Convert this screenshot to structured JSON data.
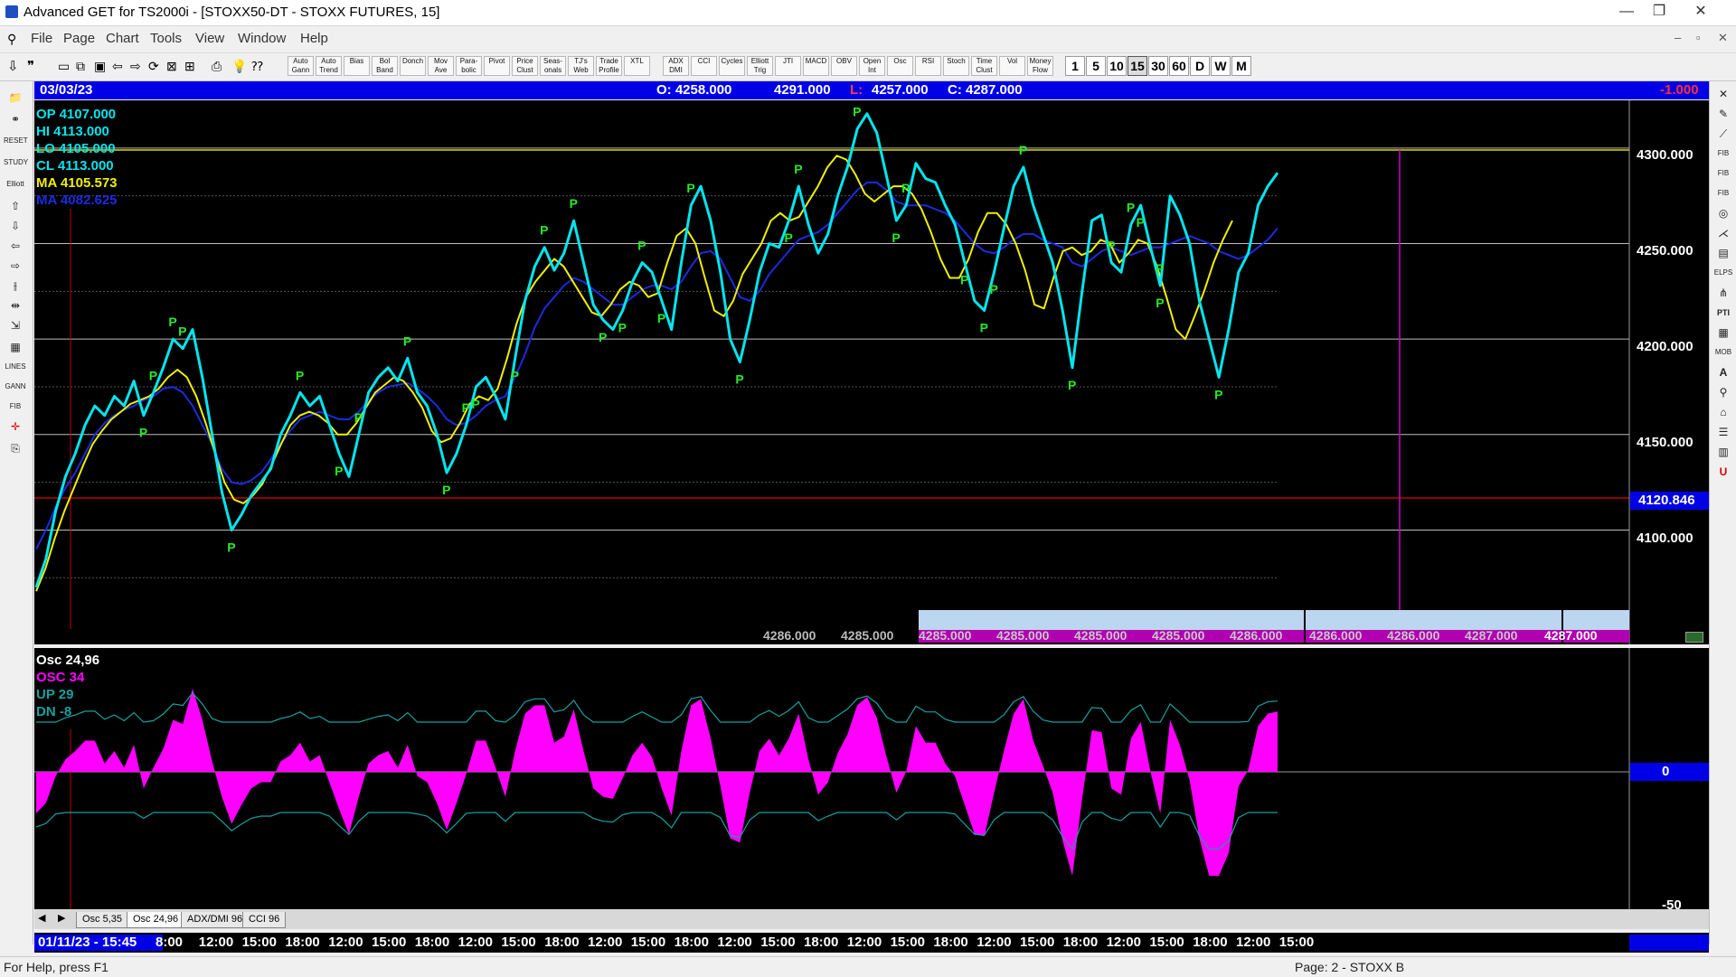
{
  "window": {
    "title": "Advanced GET for TS2000i - [STOXX50-DT - STOXX FUTURES, 15]",
    "minimize": "—",
    "restore": "❐",
    "close": "✕",
    "child_min": "–",
    "child_restore": "▫",
    "child_close": "✕"
  },
  "menu": [
    "File",
    "Page",
    "Chart",
    "Tools",
    "View",
    "Window",
    "Help"
  ],
  "toolbar": {
    "study_buttons": [
      "Auto Gann",
      "Auto Trend",
      "Bias",
      "Bol Band",
      "Donch",
      "Mov Ave",
      "Para- bolic",
      "Pivot",
      "Price Clust",
      "Seas- onals",
      "TJ's Web",
      "Trade Profile",
      "XTL",
      "ADX DMI",
      "CCI",
      "Cycles",
      "Elliott Trig",
      "JTI",
      "MACD",
      "OBV",
      "Open Int",
      "Osc",
      "RSI",
      "Stoch",
      "Time Clust",
      "Vol",
      "Money Flow"
    ],
    "timeframes": [
      "1",
      "5",
      "10",
      "15",
      "30",
      "60",
      "D",
      "W",
      "M"
    ],
    "active_timeframe": "15"
  },
  "infobar": {
    "date": "03/03/23",
    "open": "O: 4258.000",
    "high": "4291.000",
    "low_label": "L:",
    "low": "4257.000",
    "close": "C: 4287.000",
    "change": "-1.000"
  },
  "legend": {
    "op": "OP  4107.000",
    "hi": "HI   4113.000",
    "lo": "LO  4105.000",
    "cl": "CL  4113.000",
    "ma1": "MA  4105.573",
    "ma2": "MA  4082.625"
  },
  "price_axis": {
    "labels": [
      "4300.000",
      "4250.000",
      "4200.000",
      "4150.000",
      "4100.000"
    ],
    "marker": "4120.846"
  },
  "price_clusters": [
    "4286.000",
    "4285.000",
    "4285.000",
    "4285.000",
    "4285.000",
    "4285.000",
    "4286.000",
    "4286.000",
    "4286.000",
    "4287.000",
    "4287.000"
  ],
  "oscillator": {
    "title": "Osc 24,96",
    "osc": "OSC 34",
    "up": "UP   29",
    "dn": "DN   -8",
    "zero": "0",
    "minus50": "-50"
  },
  "tabs": [
    "Osc 5,35",
    "Osc 24,96",
    "ADX/DMI 96",
    "CCI 96"
  ],
  "time_axis": [
    "01/11/23 - 15:45",
    "8:00",
    "12:00",
    "15:00",
    "18:00",
    "12:00",
    "15:00",
    "18:00",
    "12:00",
    "15:00",
    "18:00",
    "12:00",
    "15:00",
    "18:00",
    "12:00",
    "15:00",
    "18:00",
    "12:00",
    "15:00",
    "18:00",
    "12:00",
    "15:00",
    "18:00",
    "12:00",
    "15:00",
    "18:00",
    "12:00",
    "15:00"
  ],
  "status": {
    "help": "For Help, press F1",
    "page": "Page: 2 - STOXX B"
  },
  "colors": {
    "price": "#00e5ee",
    "ma_fast": "#f0f000",
    "ma_slow": "#1a2be0",
    "pivot": "#27e827",
    "osc": "#ff00ff"
  },
  "chart_data": {
    "type": "line",
    "ylim": [
      4060,
      4325
    ],
    "series": [
      {
        "values": [
          4070,
          4085,
          4110,
          4128,
          4140,
          4155,
          4165,
          4160,
          4170,
          4165,
          4178,
          4160,
          4172,
          4185,
          4200,
          4195,
          4205,
          4180,
          4150,
          4120,
          4100,
          4108,
          4118,
          4125,
          4132,
          4150,
          4160,
          4172,
          4165,
          4170,
          4155,
          4140,
          4128,
          4150,
          4172,
          4180,
          4185,
          4178,
          4190,
          4172,
          4165,
          4150,
          4130,
          4140,
          4155,
          4175,
          4180,
          4170,
          4158,
          4190,
          4220,
          4238,
          4248,
          4236,
          4245,
          4262,
          4240,
          4218,
          4210,
          4205,
          4215,
          4230,
          4240,
          4235,
          4220,
          4205,
          4240,
          4270,
          4280,
          4262,
          4235,
          4200,
          4188,
          4210,
          4235,
          4250,
          4248,
          4262,
          4280,
          4260,
          4245,
          4255,
          4275,
          4290,
          4310,
          4318,
          4308,
          4285,
          4262,
          4270,
          4292,
          4284,
          4282,
          4270,
          4260,
          4240,
          4220,
          4215,
          4235,
          4258,
          4280,
          4290,
          4270,
          4255,
          4240,
          4215,
          4185,
          4225,
          4262,
          4265,
          4240,
          4235,
          4260,
          4270,
          4248,
          4228,
          4275,
          4265,
          4250,
          4220,
          4200,
          4180,
          4205,
          4235,
          4245,
          4270,
          4280,
          4287
        ]
      },
      {
        "values": [
          4090,
          4100,
          4112,
          4122,
          4130,
          4140,
          4150,
          4156,
          4160,
          4163,
          4165,
          4168,
          4170,
          4174,
          4175,
          4172,
          4165,
          4155,
          4145,
          4132,
          4125,
          4124,
          4126,
          4130,
          4137,
          4145,
          4152,
          4158,
          4160,
          4162,
          4160,
          4158,
          4158,
          4162,
          4168,
          4172,
          4175,
          4176,
          4177,
          4174,
          4170,
          4165,
          4158,
          4155,
          4156,
          4160,
          4165,
          4168,
          4170,
          4180,
          4192,
          4206,
          4216,
          4222,
          4228,
          4232,
          4230,
          4226,
          4222,
          4218,
          4218,
          4222,
          4226,
          4228,
          4228,
          4226,
          4230,
          4238,
          4245,
          4246,
          4242,
          4232,
          4222,
          4220,
          4225,
          4234,
          4240,
          4246,
          4252,
          4254,
          4256,
          4260,
          4266,
          4272,
          4278,
          4282,
          4282,
          4278,
          4272,
          4270,
          4270,
          4270,
          4268,
          4266,
          4262,
          4256,
          4250,
          4246,
          4245,
          4248,
          4252,
          4255,
          4255,
          4252,
          4250,
          4248,
          4240,
          4238,
          4242,
          4246,
          4248,
          4246,
          4244,
          4246,
          4248,
          4248,
          4250,
          4252,
          4254,
          4252,
          4250,
          4246,
          4244,
          4242,
          4244,
          4248,
          4252,
          4258
        ]
      },
      {
        "values": [
          4068,
          4080,
          4096,
          4110,
          4122,
          4134,
          4145,
          4152,
          4158,
          4162,
          4166,
          4168,
          4170,
          4174,
          4180,
          4184,
          4180,
          4170,
          4156,
          4140,
          4125,
          4116,
          4114,
          4118,
          4124,
          4134,
          4145,
          4155,
          4160,
          4162,
          4160,
          4156,
          4150,
          4150,
          4156,
          4164,
          4172,
          4176,
          4180,
          4178,
          4172,
          4164,
          4152,
          4146,
          4148,
          4156,
          4166,
          4170,
          4168,
          4174,
          4190,
          4208,
          4222,
          4230,
          4236,
          4242,
          4238,
          4230,
          4222,
          4214,
          4212,
          4218,
          4226,
          4230,
          4228,
          4222,
          4224,
          4240,
          4254,
          4258,
          4250,
          4232,
          4215,
          4212,
          4220,
          4234,
          4242,
          4250,
          4262,
          4266,
          4262,
          4264,
          4272,
          4280,
          4290,
          4296,
          4294,
          4286,
          4276,
          4272,
          4276,
          4280,
          4280,
          4276,
          4268,
          4256,
          4242,
          4232,
          4232,
          4242,
          4256,
          4266,
          4266,
          4260,
          4250,
          4236,
          4218,
          4216,
          4232,
          4246,
          4248,
          4244,
          4246,
          4252,
          4250,
          4240,
          4245,
          4252,
          4250,
          4238,
          4222,
          4205,
          4200,
          4212,
          4225,
          4240,
          4252,
          4262
        ]
      }
    ]
  }
}
